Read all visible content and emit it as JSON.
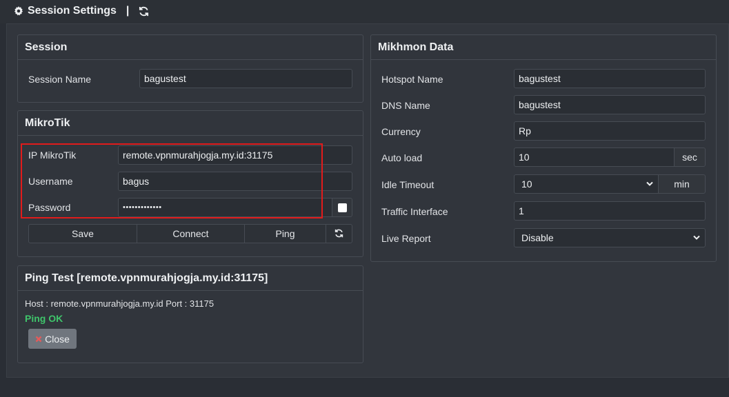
{
  "header": {
    "title": "Session Settings",
    "separator": "|"
  },
  "session": {
    "title": "Session",
    "name_label": "Session Name",
    "name_value": "bagustest"
  },
  "mikrotik": {
    "title": "MikroTik",
    "ip_label": "IP MikroTik",
    "ip_value": "remote.vpnmurahjogja.my.id:31175",
    "user_label": "Username",
    "user_value": "bagus",
    "pass_label": "Password",
    "pass_value": "•••••••••••••",
    "buttons": {
      "save": "Save",
      "connect": "Connect",
      "ping": "Ping"
    }
  },
  "ping": {
    "title": "Ping Test [remote.vpnmurahjogja.my.id:31175]",
    "host_line": "Host : remote.vpnmurahjogja.my.id Port : 31175",
    "status": "Ping OK",
    "close_label": "Close"
  },
  "mikhmon": {
    "title": "Mikhmon Data",
    "hotspot_label": "Hotspot Name",
    "hotspot_value": "bagustest",
    "dns_label": "DNS Name",
    "dns_value": "bagustest",
    "currency_label": "Currency",
    "currency_value": "Rp",
    "autoload_label": "Auto load",
    "autoload_value": "10",
    "autoload_unit": "sec",
    "idle_label": "Idle Timeout",
    "idle_value": "10",
    "idle_unit": "min",
    "traffic_label": "Traffic Interface",
    "traffic_value": "1",
    "live_label": "Live Report",
    "live_value": "Disable"
  },
  "colors": {
    "highlight": "#e21b1b",
    "ok": "#3fc56b",
    "close_icon": "#e35b5b"
  }
}
